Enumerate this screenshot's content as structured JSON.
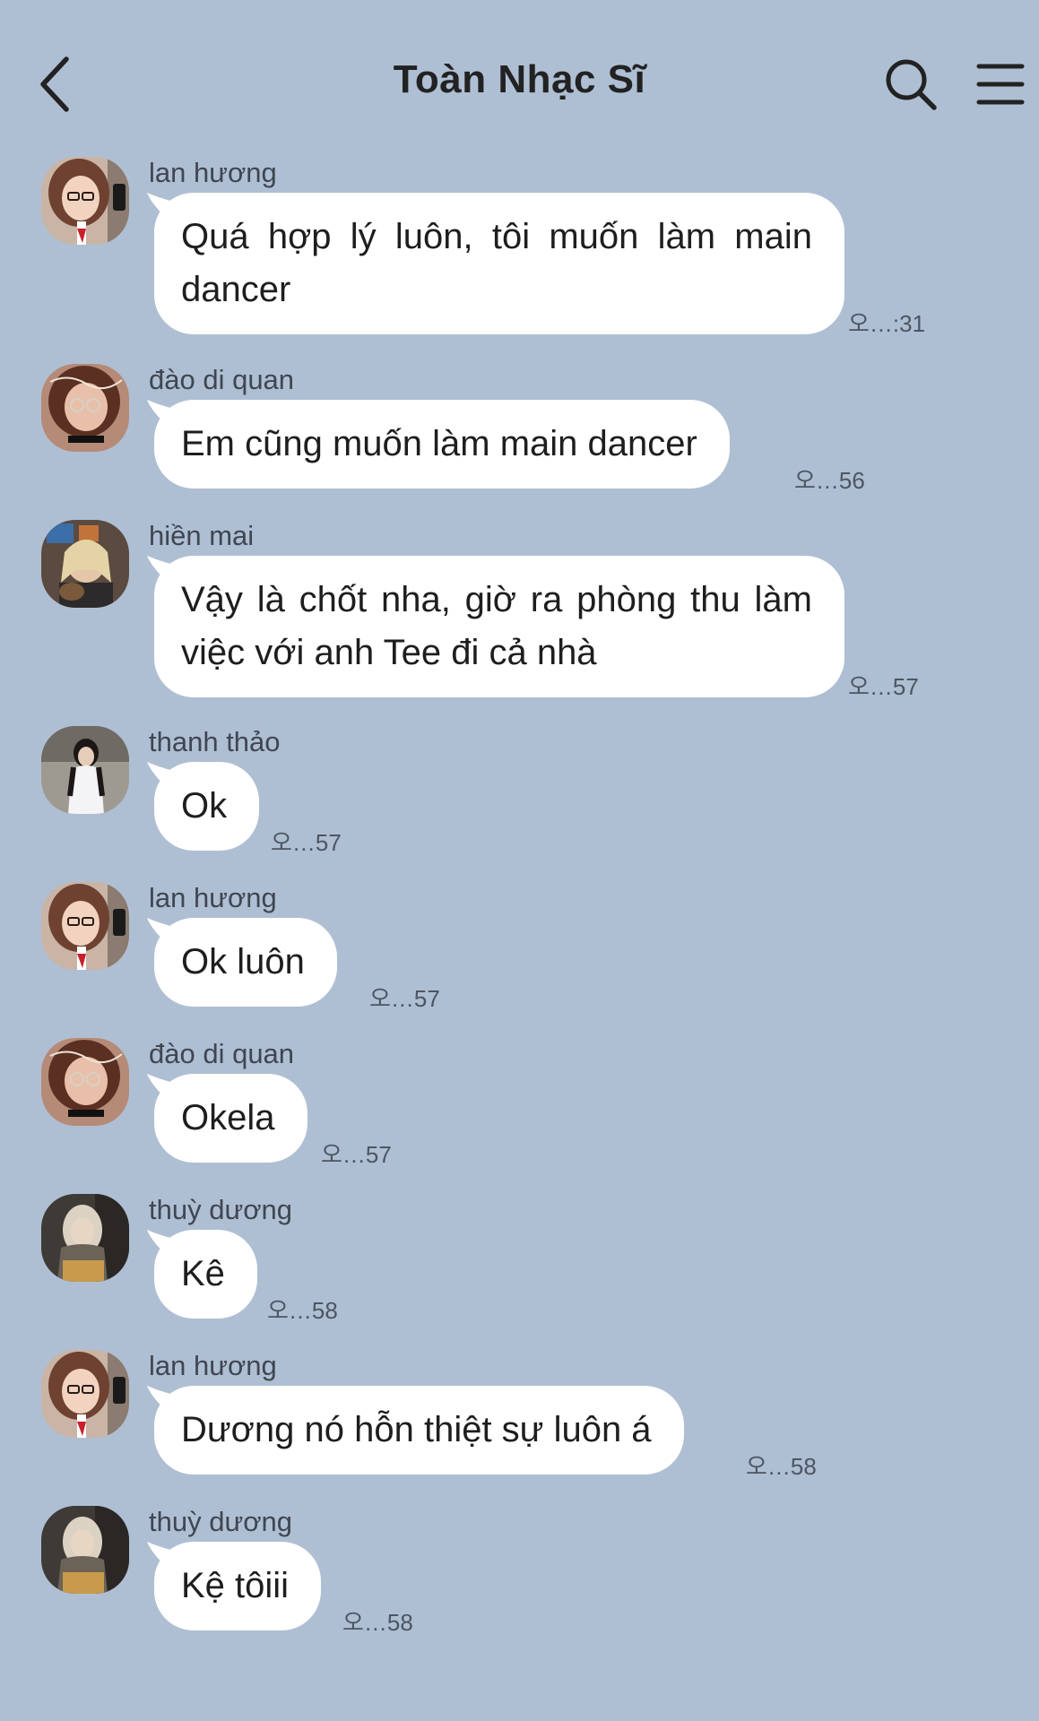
{
  "header": {
    "title": "Toàn Nhạc Sĩ",
    "back_icon": "chevron-left-icon",
    "search_icon": "search-icon",
    "menu_icon": "menu-icon"
  },
  "colors": {
    "background": "#afbfd3",
    "bubble": "#ffffff",
    "text": "#1e1e1e",
    "sender": "#3f4652",
    "time": "#4d5563"
  },
  "messages": [
    {
      "sender": "lan hương",
      "text": "Quá hợp lý luôn, tôi muốn làm main dancer",
      "time": "오…:31",
      "avatar": "avatar-lan-huong"
    },
    {
      "sender": "đào di quan",
      "text": "Em cũng muốn làm main dancer",
      "time": "오…56",
      "avatar": "avatar-dao-di-quan"
    },
    {
      "sender": "hiền mai",
      "text": "Vậy là chốt nha, giờ ra phòng thu làm việc với anh Tee đi cả nhà",
      "time": "오…57",
      "avatar": "avatar-hien-mai"
    },
    {
      "sender": "thanh thảo",
      "text": "Ok",
      "time": "오…57",
      "avatar": "avatar-thanh-thao"
    },
    {
      "sender": "lan hương",
      "text": "Ok luôn",
      "time": "오…57",
      "avatar": "avatar-lan-huong"
    },
    {
      "sender": "đào di quan",
      "text": "Okela",
      "time": "오…57",
      "avatar": "avatar-dao-di-quan"
    },
    {
      "sender": "thuỳ dương",
      "text": "Kê",
      "time": "오…58",
      "avatar": "avatar-thuy-duong"
    },
    {
      "sender": "lan hương",
      "text": "Dương nó hỗn thiệt sự luôn á",
      "time": "오…58",
      "avatar": "avatar-lan-huong"
    },
    {
      "sender": "thuỳ dương",
      "text": "Kệ tôiii",
      "time": "오…58",
      "avatar": "avatar-thuy-duong"
    }
  ]
}
